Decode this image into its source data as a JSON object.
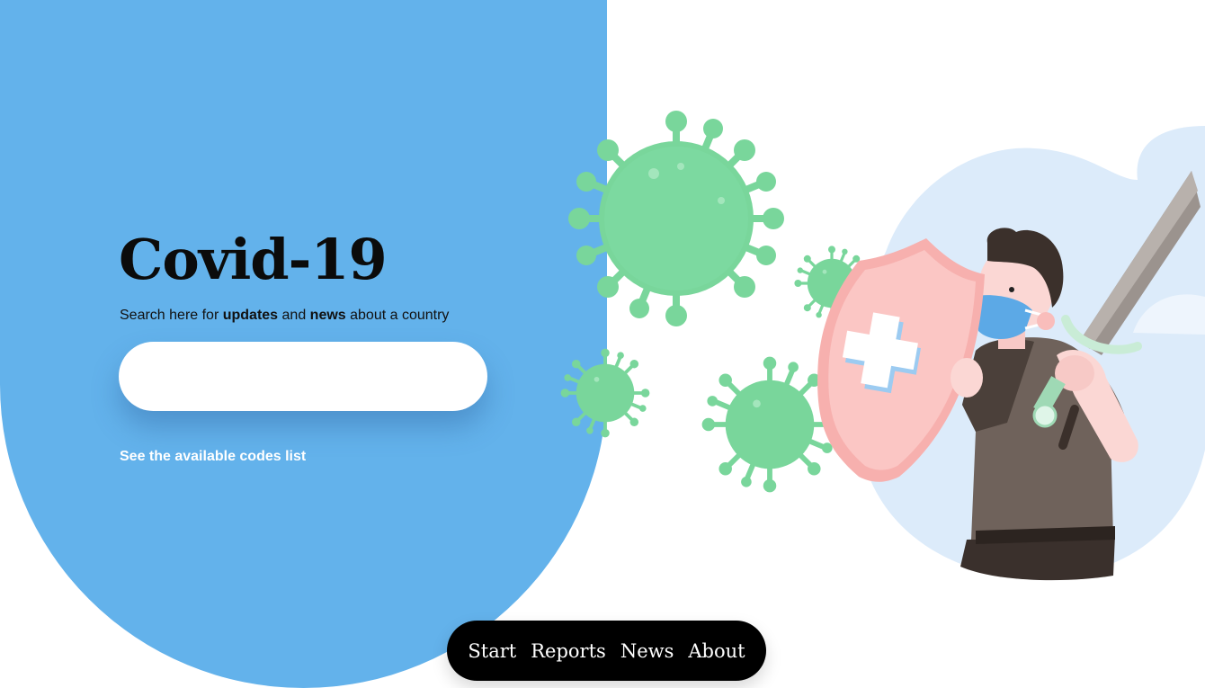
{
  "hero": {
    "title": "Covid-19",
    "subtitle": {
      "part1": "Search here for ",
      "bold1": "updates",
      "part2": " and ",
      "bold2": "news",
      "part3": " about a country"
    },
    "search": {
      "value": "",
      "placeholder": ""
    },
    "codes_link": "See the available codes list"
  },
  "nav": {
    "items": [
      "Start",
      "Reports",
      "News",
      "About"
    ]
  },
  "colors": {
    "panel": "#63b2eb",
    "virus": "#79d69b",
    "shield": "#f9bdbb",
    "blob": "#dcebfa"
  },
  "icons": [
    "virus-icon",
    "shield-icon",
    "sword-icon",
    "person-illustration"
  ]
}
